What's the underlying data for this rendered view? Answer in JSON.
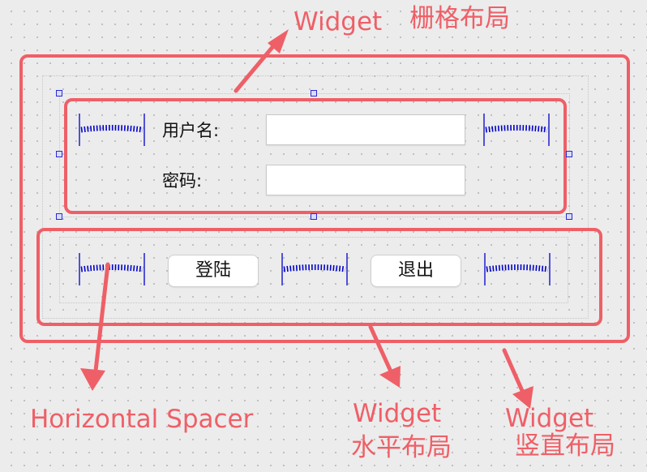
{
  "form": {
    "username_label": "用户名:",
    "password_label": "密码:",
    "username_value": "",
    "password_value": ""
  },
  "buttons": {
    "login": "登陆",
    "exit": "退出"
  },
  "annotations": {
    "top_widget": "Widget",
    "top_layout": "栅格布局",
    "horizontal_spacer": "Horizontal Spacer",
    "middle_widget": "Widget",
    "middle_layout": "水平布局",
    "right_widget": "Widget",
    "right_layout": "竖直布局"
  },
  "icons": {
    "spacer": "horizontal-spacer-icon",
    "handle": "selection-handle-icon"
  },
  "colors": {
    "annotation": "#ef5f67",
    "spacer": "#0000c8",
    "handle": "#2a2ad0"
  }
}
